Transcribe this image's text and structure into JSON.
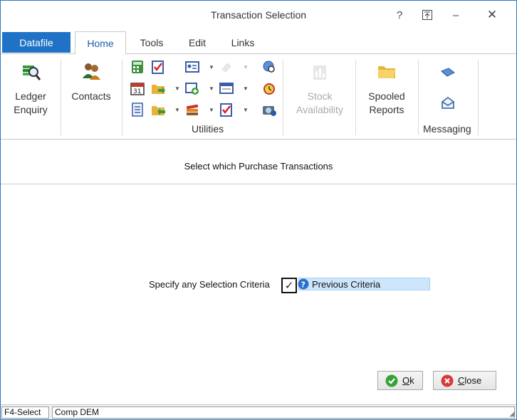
{
  "window": {
    "title": "Transaction Selection",
    "help": "?",
    "restore": "⇱",
    "minimize": "–",
    "close": "✕"
  },
  "tabs": [
    "Datafile",
    "Home",
    "Tools",
    "Edit",
    "Links"
  ],
  "ribbon": {
    "ledger": [
      "Ledger",
      "Enquiry"
    ],
    "contacts": "Contacts",
    "utilities_label": "Utilities",
    "stock": [
      "Stock",
      "Availability"
    ],
    "spooled": [
      "Spooled",
      "Reports"
    ],
    "messaging_label": "Messaging"
  },
  "main": {
    "prompt": "Select which Purchase Transactions",
    "criteria_label": "Specify any Selection Criteria",
    "checkbox_mark": "✓",
    "criteria_value": "Previous Criteria"
  },
  "buttons": {
    "ok_accel": "O",
    "ok_rest": "k",
    "close_accel": "C",
    "close_rest": "lose"
  },
  "status": {
    "f4": "F4-Select",
    "company": "Comp DEM"
  },
  "colors": {
    "accent": "#1f72c6",
    "field_bg": "#cde6fb"
  }
}
